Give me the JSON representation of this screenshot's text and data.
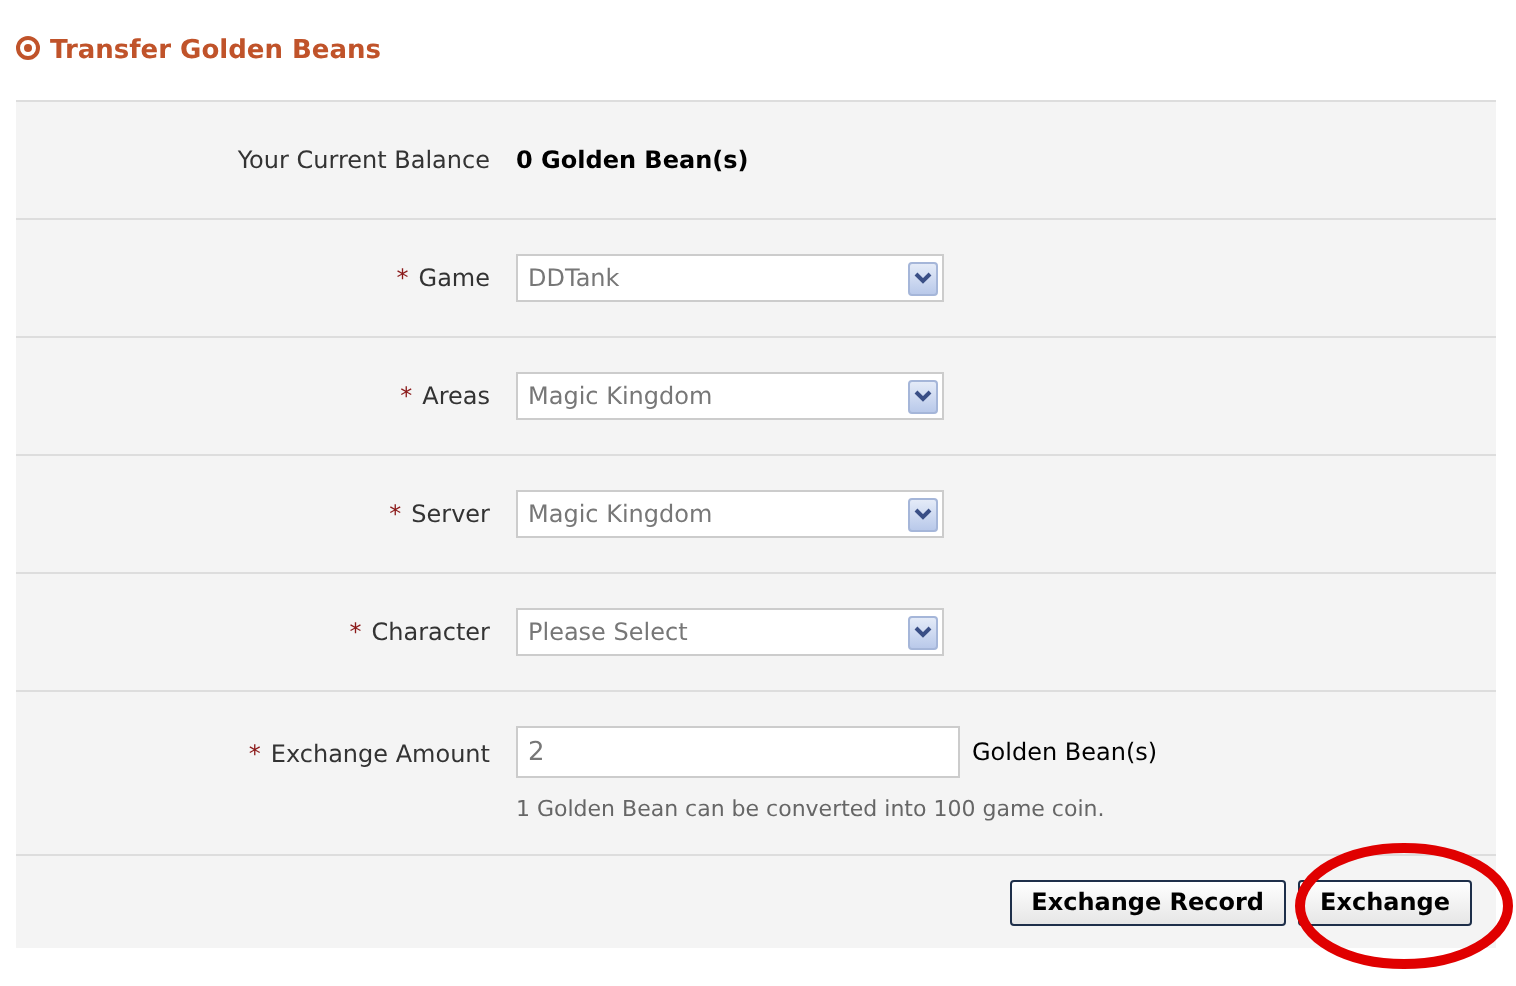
{
  "title": "Transfer Golden Beans",
  "balance": {
    "label": "Your Current Balance",
    "value": "0 Golden Bean(s)"
  },
  "fields": [
    {
      "kind": "select",
      "mark": "*",
      "label": "Game",
      "value": "DDTank"
    },
    {
      "kind": "select",
      "mark": "*",
      "label": "Areas",
      "value": "Magic Kingdom"
    },
    {
      "kind": "select",
      "mark": "*",
      "label": "Server",
      "value": "Magic Kingdom"
    },
    {
      "kind": "select",
      "mark": "*",
      "label": "Character",
      "value": "Please Select"
    },
    {
      "kind": "text",
      "mark": "*",
      "label": "Exchange Amount",
      "value": "2",
      "unit": "Golden Bean(s)",
      "hint": "1 Golden Bean can be converted into 100 game coin."
    }
  ],
  "buttons": [
    {
      "label": "Exchange Record",
      "highlighted": false
    },
    {
      "label": "Exchange",
      "highlighted": true
    }
  ]
}
